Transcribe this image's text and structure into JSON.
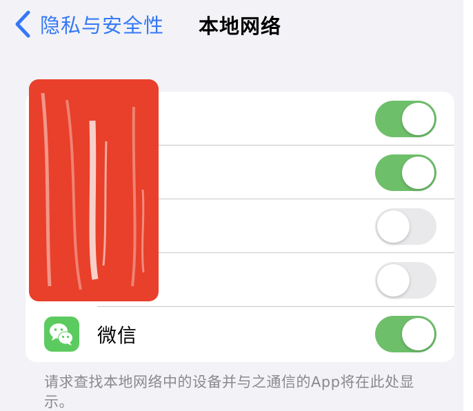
{
  "nav": {
    "back_label": "隐私与安全性",
    "title": "本地网络"
  },
  "apps": [
    {
      "name": "",
      "enabled": true,
      "redacted": true
    },
    {
      "name": "",
      "enabled": true,
      "redacted": true
    },
    {
      "name": "",
      "enabled": false,
      "redacted": true
    },
    {
      "name": "",
      "enabled": false,
      "redacted": true
    },
    {
      "name": "微信",
      "enabled": true,
      "redacted": false,
      "icon": "wechat-icon"
    }
  ],
  "footer": {
    "text": "请求查找本地网络中的设备并与之通信的App将在此处显示。"
  },
  "colors": {
    "accent": "#3478f6",
    "toggle_on": "#6ebf6a",
    "toggle_off": "#e9e9eb",
    "redaction": "#e8402a",
    "wechat": "#5ccb5f"
  }
}
